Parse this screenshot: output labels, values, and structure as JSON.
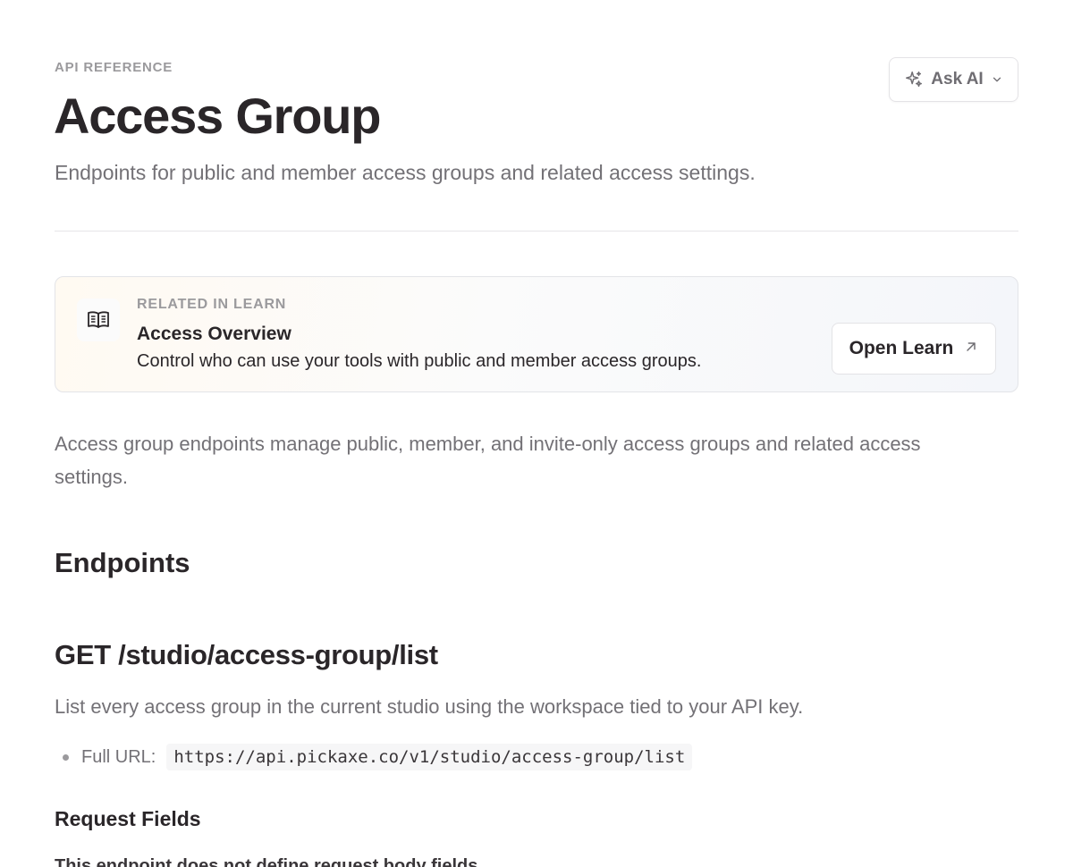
{
  "header": {
    "eyebrow": "API REFERENCE",
    "title": "Access Group",
    "subtitle": "Endpoints for public and member access groups and related access settings."
  },
  "ask_ai": {
    "label": "Ask AI",
    "icon": "sparkles-icon"
  },
  "callout": {
    "eyebrow": "RELATED IN LEARN",
    "title": "Access Overview",
    "description": "Control who can use your tools with public and member access groups.",
    "button_label": "Open Learn",
    "icon": "book-open-icon"
  },
  "intro": "Access group endpoints manage public, member, and invite-only access groups and related access settings.",
  "sections": {
    "endpoints_heading": "Endpoints",
    "endpoint": {
      "title": "GET /studio/access-group/list",
      "description": "List every access group in the current studio using the workspace tied to your API key.",
      "url_label": "Full URL:",
      "url": "https://api.pickaxe.co/v1/studio/access-group/list"
    },
    "request_fields_heading": "Request Fields",
    "request_fields_text": "This endpoint does not define request body fields."
  }
}
